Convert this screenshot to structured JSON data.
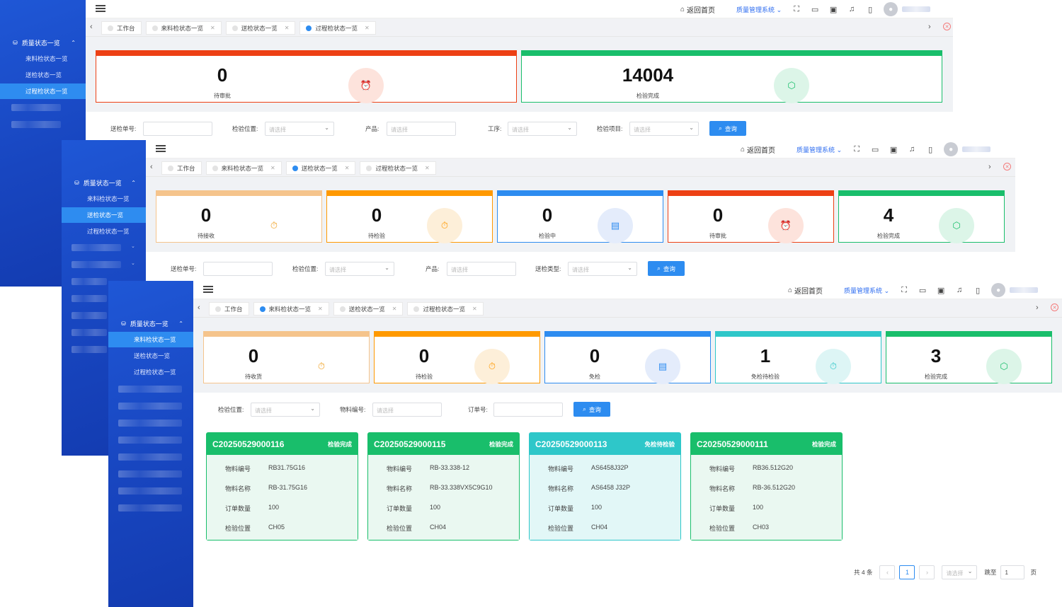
{
  "common": {
    "home_label": "返回首页",
    "system_label": "质量管理系统",
    "query_label": "查询",
    "select_placeholder": "请选择",
    "sidebar_group": "质量状态一览",
    "sidebar_items": [
      "来料检状态一览",
      "送检状态一览",
      "过程检状态一览"
    ],
    "tab_workbench": "工作台"
  },
  "colors": {
    "primary": "#2d8cf0",
    "sidebar": "#1b4fd0",
    "green": "#19be6b",
    "red": "#ed4014",
    "orange": "#ff9900",
    "teal": "#2ec7c9",
    "peach": "#f5c48c"
  },
  "win1": {
    "tabs": [
      "工作台",
      "来料检状态一览",
      "送检状态一览",
      "过程检状态一览"
    ],
    "active_tab": 3,
    "stats": [
      {
        "value": "0",
        "label": "待审批",
        "icon": "alarm-icon"
      },
      {
        "value": "14004",
        "label": "检验完成",
        "icon": "check-hex-icon"
      }
    ],
    "filters": {
      "f1": "送检单号:",
      "f2": "检验位置:",
      "f3": "产品:",
      "f4": "工序:",
      "f5": "检验项目:"
    }
  },
  "win2": {
    "tabs": [
      "工作台",
      "来料检状态一览",
      "送检状态一览",
      "过程检状态一览"
    ],
    "active_tab": 2,
    "stats": [
      {
        "value": "0",
        "label": "待接收",
        "icon": "timer-icon"
      },
      {
        "value": "0",
        "label": "待检验",
        "icon": "timer-icon"
      },
      {
        "value": "0",
        "label": "检验中",
        "icon": "clipboard-icon"
      },
      {
        "value": "0",
        "label": "待审批",
        "icon": "alarm-icon"
      },
      {
        "value": "4",
        "label": "检验完成",
        "icon": "check-hex-icon"
      }
    ],
    "filters": {
      "f1": "送检单号:",
      "f2": "检验位置:",
      "f3": "产品:",
      "f4": "送检类型:"
    }
  },
  "win3": {
    "tabs": [
      "工作台",
      "来料检状态一览",
      "送检状态一览",
      "过程检状态一览"
    ],
    "active_tab": 1,
    "stats": [
      {
        "value": "0",
        "label": "待收货",
        "icon": "timer-icon"
      },
      {
        "value": "0",
        "label": "待检验",
        "icon": "timer-icon"
      },
      {
        "value": "0",
        "label": "免检",
        "icon": "clipboard-icon"
      },
      {
        "value": "1",
        "label": "免检待检验",
        "icon": "timer-icon"
      },
      {
        "value": "3",
        "label": "检验完成",
        "icon": "check-hex-icon"
      }
    ],
    "filters": {
      "f1": "检验位置:",
      "f2": "物料编号:",
      "f3": "订单号:"
    },
    "field_labels": [
      "物料编号",
      "物料名称",
      "订单数量",
      "检验位置"
    ],
    "cards": [
      {
        "no": "C20250529000116",
        "status": "检验完成",
        "vals": [
          "RB31.75G16",
          "RB-31.75G16",
          "100",
          "CH05"
        ]
      },
      {
        "no": "C20250529000115",
        "status": "检验完成",
        "vals": [
          "RB-33.338-12",
          "RB-33.338VX5C9G10",
          "100",
          "CH04"
        ]
      },
      {
        "no": "C20250529000113",
        "status": "免检待检验",
        "vals": [
          "AS6458J32P",
          "AS6458 J32P",
          "100",
          "CH04"
        ]
      },
      {
        "no": "C20250529000111",
        "status": "检验完成",
        "vals": [
          "RB36.512G20",
          "RB-36.512G20",
          "100",
          "CH03"
        ]
      }
    ],
    "pager": {
      "total": "共 4 条",
      "page": "1",
      "jump": "跳至",
      "jump_val": "1",
      "unit": "页"
    }
  }
}
